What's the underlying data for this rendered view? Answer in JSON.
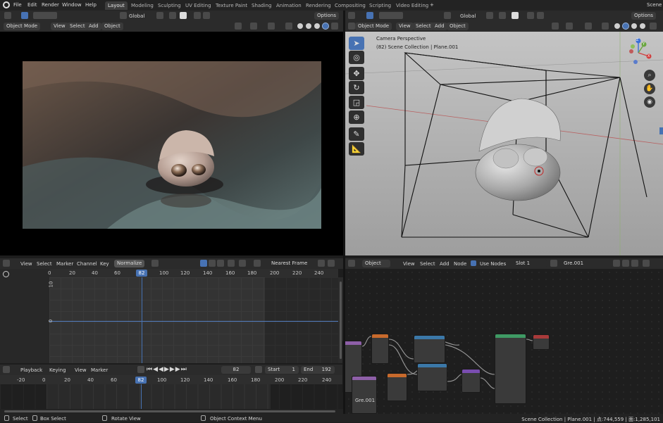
{
  "topbar": {
    "menus": [
      "File",
      "Edit",
      "Render",
      "Window",
      "Help"
    ],
    "workspaces": [
      "Layout",
      "Modeling",
      "Sculpting",
      "UV Editing",
      "Texture Paint",
      "Shading",
      "Animation",
      "Rendering",
      "Compositing",
      "Scripting",
      "Video Editing"
    ],
    "active_workspace": "Layout",
    "add_tab": "+",
    "scene": "Scene"
  },
  "left_viewport": {
    "mode": "Object Mode",
    "menus": [
      "View",
      "Select",
      "Add",
      "Object"
    ],
    "transform": "Global",
    "options": "Options"
  },
  "right_viewport": {
    "mode": "Object Mode",
    "menus": [
      "View",
      "Select",
      "Add",
      "Object"
    ],
    "transform": "Global",
    "options": "Options",
    "overlay_title": "Camera Perspective",
    "overlay_sub": "(82) Scene Collection | Plane.001",
    "gizmo": {
      "x": "X",
      "y": "Y",
      "z": "Z"
    }
  },
  "graph_editor": {
    "menus": [
      "View",
      "Select",
      "Marker",
      "Channel",
      "Key"
    ],
    "normalize": "Normalize",
    "interpolation": "Nearest Frame",
    "ruler": [
      "0",
      "20",
      "40",
      "60",
      "80",
      "100",
      "120",
      "140",
      "160",
      "180",
      "200",
      "220",
      "240"
    ],
    "current_frame": "82",
    "y_tick": "10",
    "y_tick_mid": "0"
  },
  "timeline": {
    "menus": [
      "Playback",
      "Keying",
      "View",
      "Marker"
    ],
    "frame": "82",
    "start_label": "Start",
    "start": "1",
    "end_label": "End",
    "end": "192",
    "ruler": [
      "-20",
      "0",
      "20",
      "40",
      "60",
      "80",
      "100",
      "120",
      "140",
      "160",
      "180",
      "200",
      "220",
      "240"
    ],
    "current_frame": "82"
  },
  "node_editor": {
    "type": "Object",
    "menus": [
      "View",
      "Select",
      "Add",
      "Node"
    ],
    "use_nodes_label": "Use Nodes",
    "slot": "Slot 1",
    "material": "Gre.001",
    "node_label": "Gre.001"
  },
  "statusbar": {
    "select": "Select",
    "box_select": "Box Select",
    "rotate": "Rotate View",
    "context": "Object Context Menu",
    "right": "Scene Collection | Plane.001 | 点:744,559 | 面:1,285,101"
  },
  "colors": {
    "accent": "#4772b3",
    "frame_blue": "#4772b3",
    "bg": "#1d1d1d"
  }
}
